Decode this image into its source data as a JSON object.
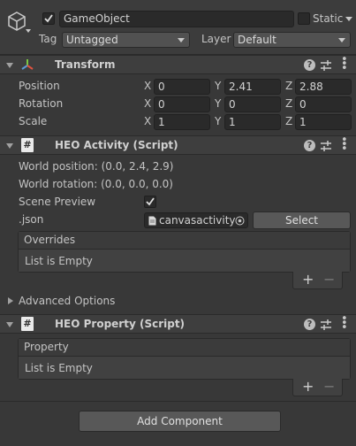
{
  "header": {
    "object_name": "GameObject",
    "static_label": "Static",
    "tag_label": "Tag",
    "tag_value": "Untagged",
    "layer_label": "Layer",
    "layer_value": "Default"
  },
  "transform": {
    "title": "Transform",
    "position": {
      "label": "Position",
      "x": "0",
      "y": "2.41",
      "z": "2.88"
    },
    "rotation": {
      "label": "Rotation",
      "x": "0",
      "y": "0",
      "z": "0"
    },
    "scale": {
      "label": "Scale",
      "x": "1",
      "y": "1",
      "z": "1"
    },
    "axis_x": "X",
    "axis_y": "Y",
    "axis_z": "Z"
  },
  "heo_activity": {
    "title": "HEO Activity (Script)",
    "world_position": "World position: (0.0, 2.4, 2.9)",
    "world_rotation": "World rotation: (0.0, 0.0, 0.0)",
    "scene_preview_label": "Scene Preview",
    "json_label": ".json",
    "json_value": "canvasactivity",
    "select_label": "Select",
    "overrides_label": "Overrides",
    "overrides_empty": "List is Empty"
  },
  "advanced_options": "Advanced Options",
  "heo_property": {
    "title": "HEO Property (Script)",
    "property_label": "Property",
    "property_empty": "List is Empty"
  },
  "add_component": "Add Component",
  "icons": {
    "help": "?",
    "plus": "+",
    "minus": "−",
    "script": "#"
  }
}
